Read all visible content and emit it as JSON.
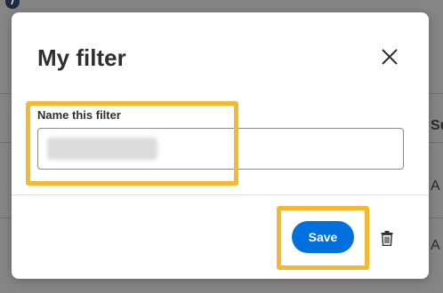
{
  "modal": {
    "title": "My filter",
    "field_label": "Name this filter",
    "field_value": "",
    "save_label": "Save"
  },
  "background": {
    "column_header_fragment": "Su",
    "cell_fragment_1": "A",
    "cell_fragment_2": "A"
  },
  "colors": {
    "primary": "#0071dc",
    "highlight": "#f5b82e"
  },
  "icons": [
    "close-icon",
    "trash-icon",
    "info-icon"
  ]
}
